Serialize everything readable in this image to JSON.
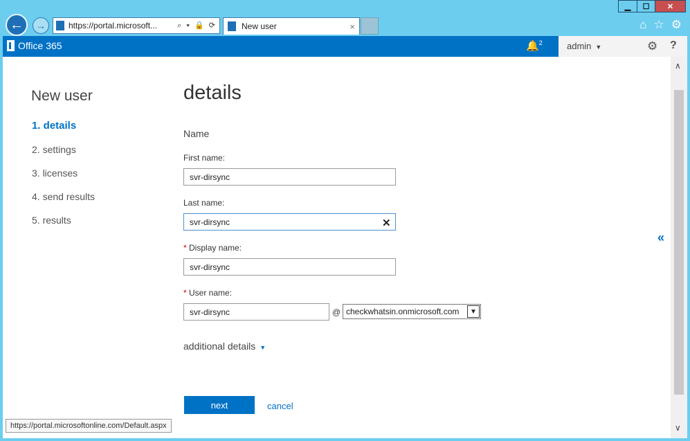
{
  "window_controls": {
    "minimize": "▁",
    "maximize": "☐",
    "close": "✕"
  },
  "browser": {
    "back_icon": "←",
    "forward_icon": "→",
    "address_url": "https://portal.microsoft...",
    "address_tools": "⌕ ▾ 🔒 ⟳",
    "tab_title": "New user",
    "tab_close": "×",
    "home_icon": "⌂",
    "favorites_icon": "☆",
    "settings_icon": "⚙"
  },
  "o365": {
    "brand": "Office 365",
    "notification_count": "2",
    "user": "admin",
    "gear_icon": "⚙",
    "help_label": "?"
  },
  "wizard": {
    "title": "New user",
    "steps": [
      {
        "label": "1.  details"
      },
      {
        "label": "2.  settings"
      },
      {
        "label": "3.  licenses"
      },
      {
        "label": "4.  send results"
      },
      {
        "label": "5.  results"
      }
    ]
  },
  "form": {
    "heading": "details",
    "section": "Name",
    "first_name_label": "First name:",
    "first_name_value": "svr-dirsync",
    "last_name_label": "Last name:",
    "last_name_value": "svr-dirsync",
    "display_name_label": "Display name:",
    "display_name_value": "svr-dirsync",
    "user_name_label": "User name:",
    "user_name_value": "svr-dirsync",
    "required_mark": "*",
    "at_sign": "@",
    "domain_value": "checkwhatsin.onmicrosoft.com",
    "additional_details": "additional details",
    "next_label": "next",
    "cancel_label": "cancel",
    "collapse_icon": "«"
  },
  "status_bar": {
    "url": "https://portal.microsoftonline.com/Default.aspx"
  },
  "colors": {
    "accent": "#0072c6",
    "chrome": "#6ccdef",
    "close": "#c74f50"
  }
}
